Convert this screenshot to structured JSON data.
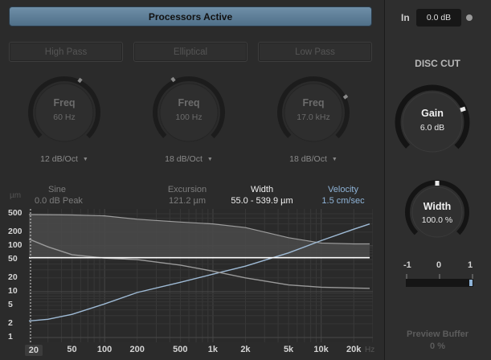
{
  "processors_button": "Processors Active",
  "filters": [
    {
      "mode": "High Pass",
      "knob_title": "Freq",
      "knob_value": "60 Hz",
      "slope": "12 dB/Oct"
    },
    {
      "mode": "Elliptical",
      "knob_title": "Freq",
      "knob_value": "100 Hz",
      "slope": "18 dB/Oct"
    },
    {
      "mode": "Low Pass",
      "knob_title": "Freq",
      "knob_value": "17.0 kHz",
      "slope": "18 dB/Oct"
    }
  ],
  "info": {
    "unit": "µm",
    "sine_label": "Sine",
    "sine_value": "0.0 dB Peak",
    "excursion_label": "Excursion",
    "excursion_value": "121.2 µm",
    "width_label": "Width",
    "width_value": "55.0 - 539.9 µm",
    "velocity_label": "Velocity",
    "velocity_value": "1.5 cm/sec"
  },
  "graph": {
    "y_ticks": [
      "500",
      "200",
      "100",
      "50",
      "20",
      "10",
      "5",
      "2",
      "1"
    ],
    "x_ticks": [
      "20",
      "50",
      "100",
      "200",
      "500",
      "1k",
      "2k",
      "5k",
      "10k",
      "20k"
    ],
    "x_unit": "Hz"
  },
  "chart_data": {
    "type": "line",
    "xlabel": "",
    "ylabel": "µm",
    "x_scale": "log",
    "y_scale": "log",
    "xlim": [
      20,
      30000
    ],
    "ylim": [
      1,
      500
    ],
    "grid": true,
    "series": [
      {
        "color": "#9fbbd6",
        "x": [
          20,
          30,
          50,
          100,
          200,
          500,
          1000,
          2000,
          5000,
          10000,
          20000,
          28000
        ],
        "y": [
          2.3,
          2.5,
          3.2,
          5.4,
          9.6,
          16,
          24,
          36,
          70,
          130,
          230,
          300
        ]
      },
      {
        "color": "#9a9a9a",
        "x": [
          20,
          30,
          50,
          100,
          200,
          500,
          1000,
          2000,
          5000,
          10000,
          20000,
          28000
        ],
        "y": [
          140,
          95,
          64,
          54,
          50,
          38,
          28,
          20,
          14,
          12.5,
          12,
          11.8
        ]
      },
      {
        "color": "#ffffff",
        "x": [
          20,
          28000
        ],
        "y": [
          55,
          55
        ]
      },
      {
        "color": "#c8c8c8",
        "x": [
          20,
          50,
          100,
          200,
          500,
          1000,
          2000,
          5000,
          10000,
          20000,
          28000
        ],
        "y": [
          480,
          470,
          450,
          380,
          330,
          300,
          250,
          150,
          115,
          110,
          110
        ]
      }
    ]
  },
  "input": {
    "label": "In",
    "value": "0.0 dB"
  },
  "disc_cut": {
    "title": "DISC CUT",
    "gain_label": "Gain",
    "gain_value": "6.0 dB",
    "width_label": "Width",
    "width_value": "100.0 %"
  },
  "meter": {
    "left": "-1",
    "center": "0",
    "right": "1",
    "level": 1.0
  },
  "preview": {
    "label": "Preview Buffer",
    "value": "0 %"
  },
  "colors": {
    "accent": "#6f8fa8",
    "curve_blue": "#9fbbd6"
  }
}
